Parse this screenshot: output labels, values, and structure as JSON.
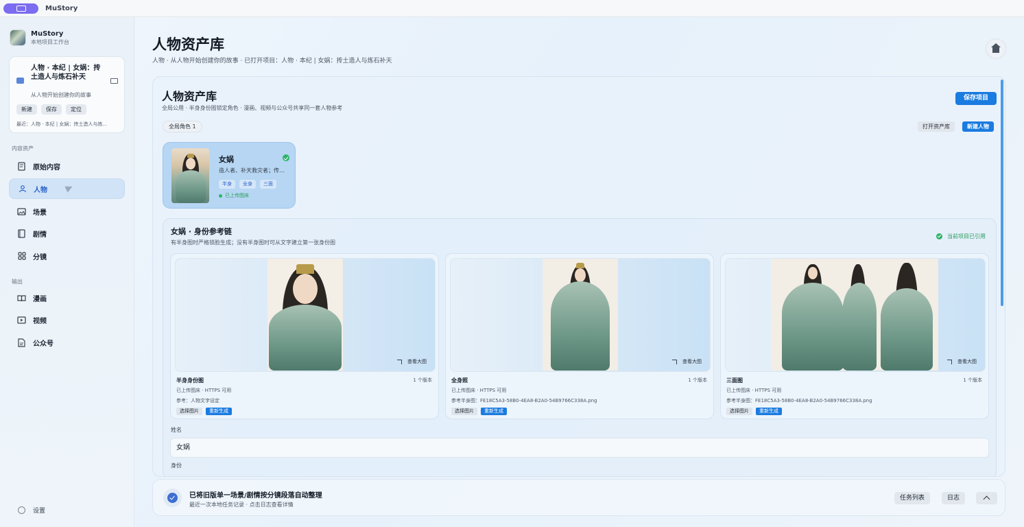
{
  "window": {
    "app_title": "MuStory"
  },
  "sidebar": {
    "brand_name": "MuStory",
    "brand_sub": "本地项目工作台",
    "project": {
      "title": "人物 · 本纪 | 女娲：抟土造人与炼石补天",
      "desc": "从人物开始创建你的故事",
      "buttons": [
        "新建",
        "保存",
        "定位"
      ],
      "recent": "最近：人物 · 本纪 | 女娲：抟土造人与炼..."
    },
    "section_assets": "内容资产",
    "assets": [
      {
        "label": "原始内容",
        "icon": "document-icon"
      },
      {
        "label": "人物",
        "icon": "person-icon",
        "active": true
      },
      {
        "label": "场景",
        "icon": "image-icon"
      },
      {
        "label": "剧情",
        "icon": "book-icon"
      },
      {
        "label": "分镜",
        "icon": "grid-icon"
      }
    ],
    "section_output": "输出",
    "outputs": [
      {
        "label": "漫画",
        "icon": "open-book-icon"
      },
      {
        "label": "视频",
        "icon": "play-icon"
      },
      {
        "label": "公众号",
        "icon": "file-icon"
      }
    ],
    "settings_label": "设置"
  },
  "header": {
    "title": "人物资产库",
    "subtitle": "人物 · 从人物开始创建你的故事 · 已打开项目：人物 · 本纪 | 女娲：抟土造人与炼石补天"
  },
  "library": {
    "title": "人物资产库",
    "subtitle": "全局公用 · 半身身份图锁定角色 · 漫画、视频与公众号共享同一套人物参考",
    "save_label": "保存项目",
    "count_chip": "全局角色 1",
    "open_lib_label": "打开资产库",
    "new_char_label": "新建人物"
  },
  "character": {
    "name": "女娲",
    "desc": "造人者、补天救灾者；传…",
    "tags": [
      "半身",
      "全身",
      "三面"
    ],
    "status": "已上传图床"
  },
  "chain": {
    "title": "女娲 · 身份参考链",
    "subtitle": "有半身图时严格锁脸生成；没有半身图时可从文字建立第一张身份图",
    "ref_status": "当前项目已引用",
    "view_large": "查看大图",
    "cards": [
      {
        "name": "半身身份图",
        "version": "1 个版本",
        "line1": "已上传图床 · HTTPS 可用",
        "line2": "参考：人物文字设定",
        "btn_select": "选择图片",
        "btn_regen": "重新生成"
      },
      {
        "name": "全身照",
        "version": "1 个版本",
        "line1": "已上传图床 · HTTPS 可用",
        "line2": "参考半身图：FE18C5A3-58B0-4EA8-B2A0-54B9766C338A.png",
        "btn_select": "选择图片",
        "btn_regen": "重新生成"
      },
      {
        "name": "三面图",
        "version": "1 个版本",
        "line1": "已上传图床 · HTTPS 可用",
        "line2": "参考半身图：FE18C5A3-58B0-4EA8-B2A0-54B9766C338A.png",
        "btn_select": "选择图片",
        "btn_regen": "重新生成"
      }
    ],
    "name_label": "姓名",
    "name_value": "女娲",
    "identity_label": "身份"
  },
  "bottom": {
    "title": "已将旧版单一场景/剧情按分镜段落自动整理",
    "subtitle": "最近一次本地任务记录 · 点击日志查看详情",
    "task_list": "任务列表",
    "log": "日志"
  }
}
